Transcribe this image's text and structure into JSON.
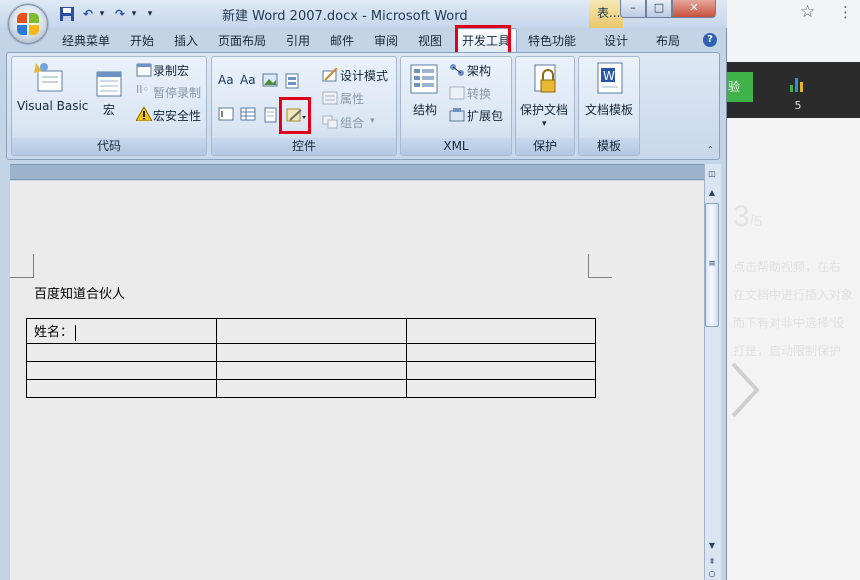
{
  "window": {
    "title": "新建 Word 2007.docx - Microsoft Word",
    "context_tab": "表...",
    "controls": {
      "minimize": "–",
      "maximize": "□",
      "close": "✕"
    }
  },
  "quick_access": {
    "save": "save-icon",
    "undo": "↶",
    "redo": "↷",
    "more": "▾"
  },
  "tabs": [
    {
      "label": "经典菜单"
    },
    {
      "label": "开始"
    },
    {
      "label": "插入"
    },
    {
      "label": "页面布局"
    },
    {
      "label": "引用"
    },
    {
      "label": "邮件"
    },
    {
      "label": "审阅"
    },
    {
      "label": "视图"
    },
    {
      "label": "开发工具",
      "active": true
    },
    {
      "label": "特色功能"
    },
    {
      "label": "设计"
    },
    {
      "label": "布局"
    }
  ],
  "help": "?",
  "ribbon": {
    "code": {
      "label": "代码",
      "visual_basic": "Visual Basic",
      "macro": "宏",
      "record_macro": "录制宏",
      "pause_recording": "暂停录制",
      "macro_security": "宏安全性"
    },
    "controls": {
      "label": "控件",
      "aa1": "Aa",
      "aa2": "Aa",
      "design_mode": "设计模式",
      "properties": "属性",
      "group": "组合"
    },
    "xml": {
      "label": "XML",
      "structure": "结构",
      "schema": "架构",
      "transform": "转换",
      "expansion_pack": "扩展包"
    },
    "protect": {
      "label": "保护",
      "protect_document": "保护文档"
    },
    "templates": {
      "label": "模板",
      "document_template": "文档模板"
    }
  },
  "document": {
    "text": "百度知道合伙人",
    "table": [
      [
        "姓名：",
        "",
        ""
      ],
      [
        "",
        "",
        ""
      ],
      [
        "",
        "",
        ""
      ],
      [
        "",
        "",
        ""
      ]
    ]
  },
  "background_page": {
    "green_button": "验",
    "count": "5",
    "step": "3",
    "step_total": "/5",
    "lines": [
      "点击帮助视频，在右",
      "在文档中进行插入对象",
      "而下有对非中选择'设",
      "打是，启动限制保护"
    ]
  }
}
